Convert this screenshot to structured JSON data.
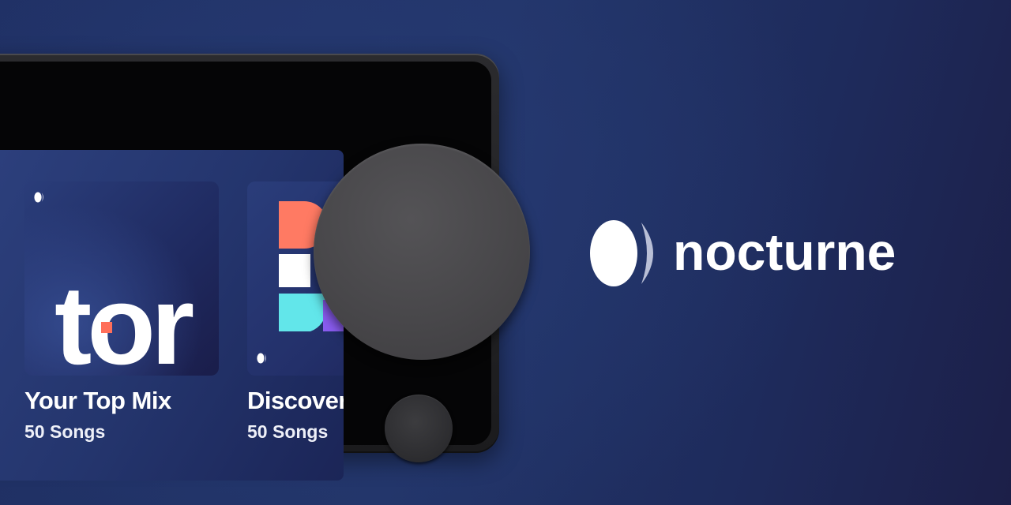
{
  "brand": {
    "name": "nocturne",
    "logo_icon": "nocturne-moon-logo"
  },
  "cards": [
    {
      "title": "Your Top Mix",
      "subtitle": "50 Songs",
      "art_text": "tor",
      "art_icon": "top-mix-cover-art"
    },
    {
      "title": "Discover",
      "subtitle": "50 Songs",
      "art_icon": "discover-cover-art"
    }
  ],
  "colors": {
    "background": "#223569",
    "accent_coral": "#ff7a63",
    "accent_cyan": "#62e6ea",
    "accent_purple": "#8a5cf0",
    "text": "#ffffff"
  }
}
